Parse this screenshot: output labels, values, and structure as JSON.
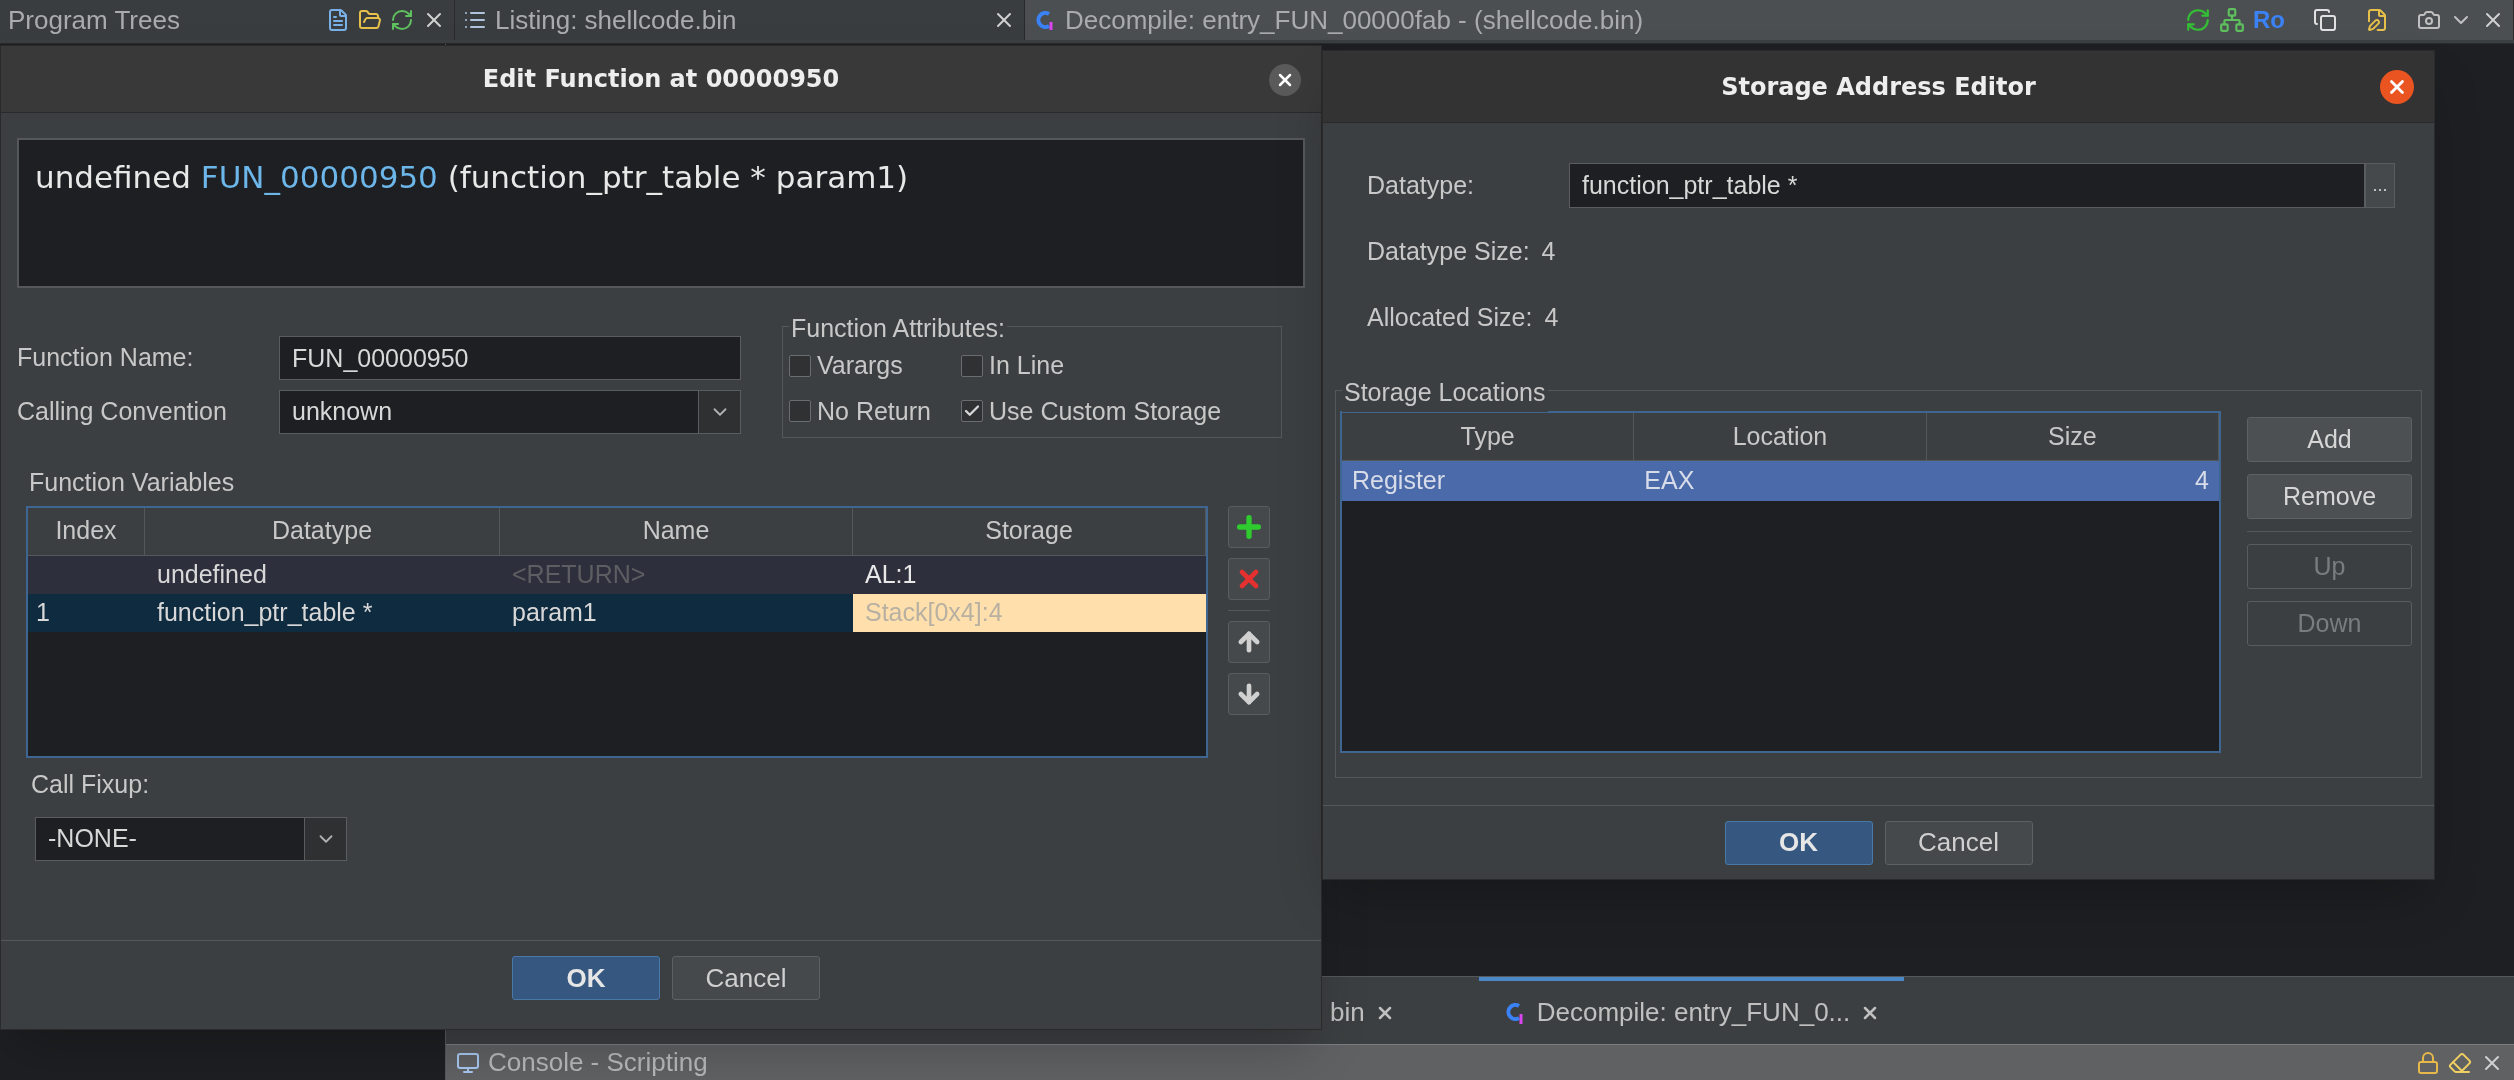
{
  "top_tabs": [
    {
      "label": "Program Trees",
      "kind": "trees",
      "selected": false
    },
    {
      "label": "Listing:  shellcode.bin",
      "kind": "listing",
      "selected": false
    },
    {
      "label": "Decompile: entry_FUN_00000fab -  (shellcode.bin)",
      "kind": "decompile",
      "selected": true
    }
  ],
  "decompile_toolbar": {
    "ro_label": "Ro"
  },
  "edit_function": {
    "title": "Edit Function at 00000950",
    "signature": {
      "return_type": "undefined",
      "name": "FUN_00000950",
      "params": "(function_ptr_table * param1)"
    },
    "function_name": {
      "label": "Function Name:",
      "value": "FUN_00000950"
    },
    "calling_convention": {
      "label": "Calling Convention",
      "value": "unknown"
    },
    "attributes": {
      "title": "Function Attributes:",
      "options": [
        {
          "label": "Varargs",
          "checked": false
        },
        {
          "label": "In Line",
          "checked": false
        },
        {
          "label": "No Return",
          "checked": false
        },
        {
          "label": "Use Custom Storage",
          "checked": true
        }
      ]
    },
    "variables": {
      "title": "Function Variables",
      "columns": [
        "Index",
        "Datatype",
        "Name",
        "Storage"
      ],
      "rows": [
        {
          "datatype": "undefined",
          "name": "<RETURN>",
          "name_disabled": true,
          "storage": "AL:1",
          "editing": false,
          "selected": false
        },
        {
          "index": "1",
          "datatype": "function_ptr_table *",
          "name": "param1",
          "name_disabled": false,
          "storage": "Stack[0x4]:4",
          "editing": true,
          "selected": true
        }
      ]
    },
    "call_fixup": {
      "label": "Call Fixup:",
      "value": "-NONE-"
    },
    "buttons": [
      {
        "label": "OK",
        "kind": "primary"
      },
      {
        "label": "Cancel",
        "kind": "default"
      }
    ]
  },
  "storage_editor": {
    "title": "Storage Address Editor",
    "datatype": {
      "label": "Datatype:",
      "value": "function_ptr_table *",
      "browse": "..."
    },
    "datatype_size": {
      "label": "Datatype Size:",
      "value": "4"
    },
    "allocated_size": {
      "label": "Allocated Size:",
      "value": "4"
    },
    "locations": {
      "title": "Storage Locations",
      "columns": [
        "Type",
        "Location",
        "Size"
      ],
      "rows": [
        {
          "type": "Register",
          "location": "EAX",
          "size": "4",
          "selected": true
        }
      ]
    },
    "edit_buttons": [
      {
        "label": "Add",
        "disabled": false
      },
      {
        "label": "Remove",
        "disabled": false
      }
    ],
    "move_buttons": [
      {
        "label": "Up",
        "disabled": true
      },
      {
        "label": "Down",
        "disabled": true
      }
    ],
    "buttons": [
      {
        "label": "OK",
        "kind": "primary"
      },
      {
        "label": "Cancel",
        "kind": "default"
      }
    ]
  },
  "bottom_tabs": [
    {
      "label": "bin",
      "selected": false
    },
    {
      "label": "Decompile: entry_FUN_0...",
      "selected": true
    }
  ],
  "console": {
    "title": "Console - Scripting"
  }
}
